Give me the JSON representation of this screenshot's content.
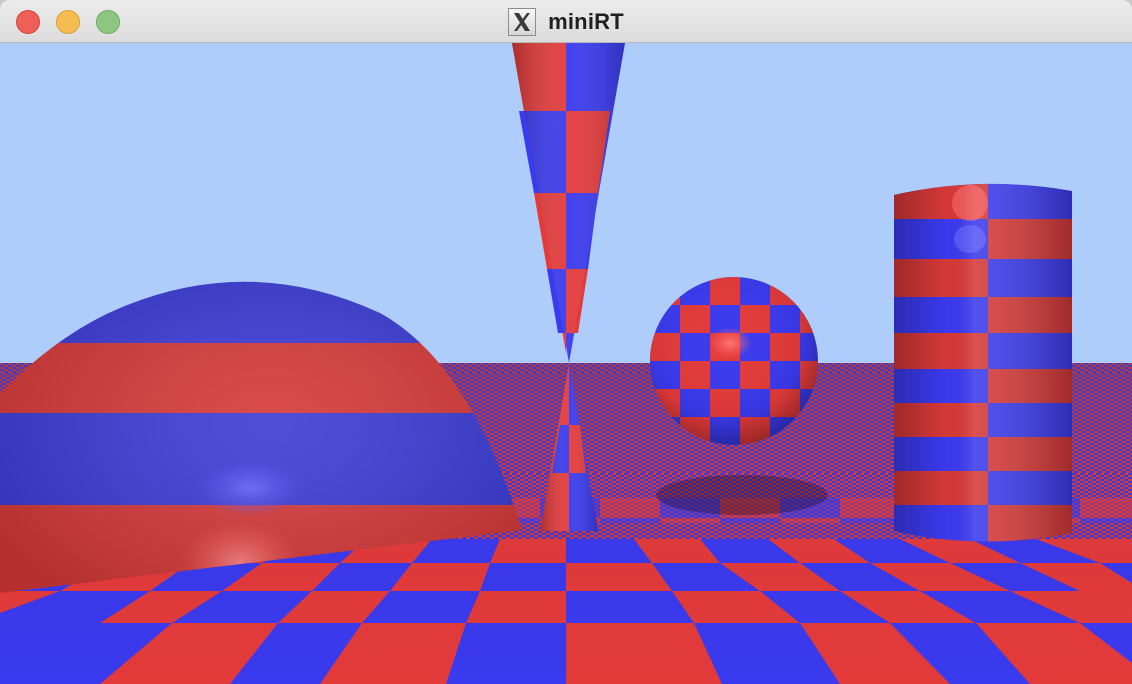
{
  "window": {
    "title": "miniRT",
    "app_icon": "x11-icon"
  },
  "controls": {
    "close": "close-button",
    "minimize": "minimize-button",
    "zoom": "zoom-button"
  },
  "scene": {
    "sky_color": "#aecdfa",
    "checker_red": "#e33a3a",
    "checker_blue": "#3a3aee",
    "objects": [
      "plane",
      "hemisphere",
      "double-cone",
      "sphere",
      "cylinder"
    ]
  }
}
